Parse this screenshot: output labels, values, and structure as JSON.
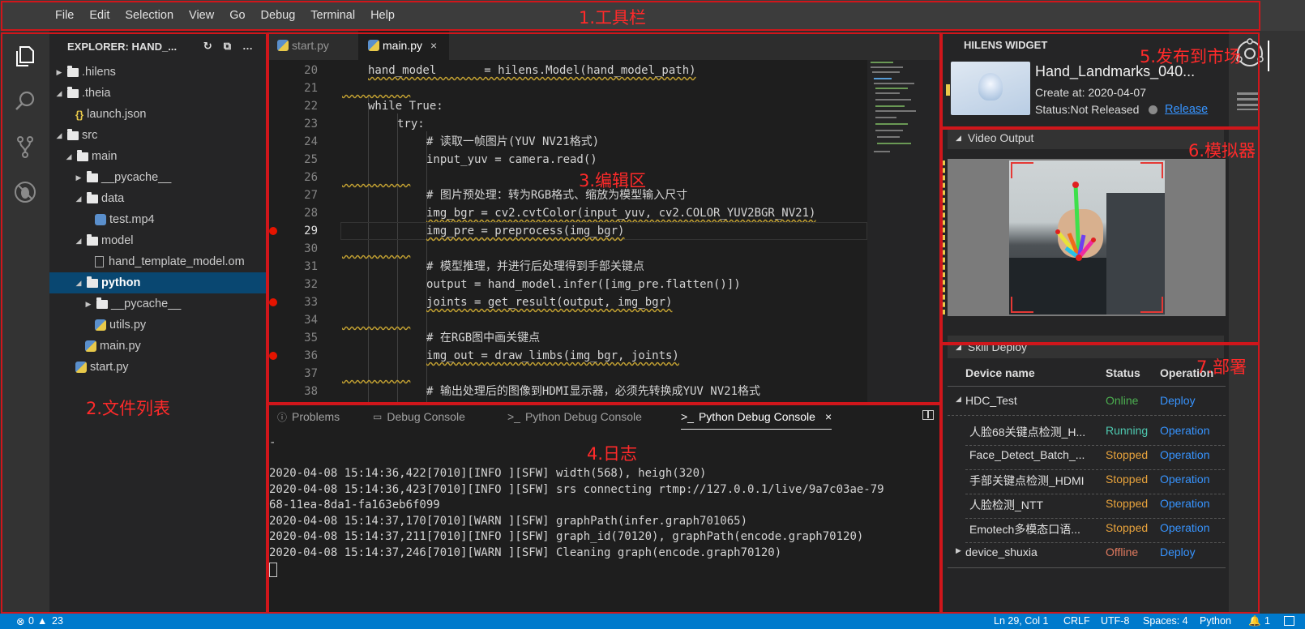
{
  "menubar": {
    "items": [
      "File",
      "Edit",
      "Selection",
      "View",
      "Go",
      "Debug",
      "Terminal",
      "Help"
    ]
  },
  "annotations": {
    "toolbar": "1.工具栏",
    "file_list": "2.文件列表",
    "editor": "3.编辑区",
    "log": "4.日志",
    "publish": "5.发布到市场",
    "simulator": "6.模拟器",
    "deploy": "7.部署"
  },
  "explorer": {
    "title": "EXPLORER: HAND_...",
    "tree": [
      {
        "label": ".hilens",
        "type": "folder",
        "depth": 0,
        "open": false
      },
      {
        "label": ".theia",
        "type": "folder",
        "depth": 0,
        "open": true
      },
      {
        "label": "launch.json",
        "type": "json",
        "depth": 1
      },
      {
        "label": "src",
        "type": "folder",
        "depth": 0,
        "open": true
      },
      {
        "label": "main",
        "type": "folder",
        "depth": 1,
        "open": true
      },
      {
        "label": "__pycache__",
        "type": "folder",
        "depth": 2,
        "open": false
      },
      {
        "label": "data",
        "type": "folder",
        "depth": 2,
        "open": true
      },
      {
        "label": "test.mp4",
        "type": "media",
        "depth": 3
      },
      {
        "label": "model",
        "type": "folder",
        "depth": 2,
        "open": true
      },
      {
        "label": "hand_template_model.om",
        "type": "file",
        "depth": 3
      },
      {
        "label": "python",
        "type": "folder",
        "depth": 2,
        "open": true,
        "selected": true
      },
      {
        "label": "__pycache__",
        "type": "folder",
        "depth": 3,
        "open": false
      },
      {
        "label": "utils.py",
        "type": "py",
        "depth": 3
      },
      {
        "label": "main.py",
        "type": "py",
        "depth": 2
      },
      {
        "label": "start.py",
        "type": "py",
        "depth": 1
      }
    ]
  },
  "editor": {
    "tabs": [
      {
        "label": "start.py",
        "active": false
      },
      {
        "label": "main.py",
        "active": true,
        "close": "×"
      }
    ],
    "lines": [
      {
        "n": "20",
        "code": "hand_model       = hilens.Model(hand_model_path)",
        "indent": 0,
        "kind": "code",
        "sq": true
      },
      {
        "n": "21",
        "code": "",
        "indent": 0,
        "kind": "blank",
        "sq": true
      },
      {
        "n": "22",
        "code": "while True:",
        "indent": 0,
        "kind": "kw"
      },
      {
        "n": "23",
        "code": "try:",
        "indent": 1,
        "kind": "kw"
      },
      {
        "n": "24",
        "code": "# 读取一帧图片(YUV NV21格式)",
        "indent": 2,
        "kind": "cm"
      },
      {
        "n": "25",
        "code": "input_yuv = camera.read()",
        "indent": 2,
        "kind": "code"
      },
      {
        "n": "26",
        "code": "",
        "indent": 0,
        "kind": "blank",
        "sq": true
      },
      {
        "n": "27",
        "code": "# 图片预处理：转为RGB格式、缩放为模型输入尺寸",
        "indent": 2,
        "kind": "cm"
      },
      {
        "n": "28",
        "code": "img_bgr = cv2.cvtColor(input_yuv, cv2.COLOR_YUV2BGR_NV21)",
        "indent": 2,
        "kind": "code",
        "sq": true
      },
      {
        "n": "29",
        "code": "img_pre = preprocess(img_bgr)",
        "indent": 2,
        "kind": "code",
        "bp": true,
        "cur": true,
        "sq": true
      },
      {
        "n": "30",
        "code": "",
        "indent": 0,
        "kind": "blank",
        "sq": true
      },
      {
        "n": "31",
        "code": "# 模型推理，并进行后处理得到手部关键点",
        "indent": 2,
        "kind": "cm"
      },
      {
        "n": "32",
        "code": "output = hand_model.infer([img_pre.flatten()])",
        "indent": 2,
        "kind": "code"
      },
      {
        "n": "33",
        "code": "joints = get_result(output, img_bgr)",
        "indent": 2,
        "kind": "code",
        "bp": true,
        "sq": true
      },
      {
        "n": "34",
        "code": "",
        "indent": 0,
        "kind": "blank",
        "sq": true
      },
      {
        "n": "35",
        "code": "# 在RGB图中画关键点",
        "indent": 2,
        "kind": "cm"
      },
      {
        "n": "36",
        "code": "img_out = draw_limbs(img_bgr, joints)",
        "indent": 2,
        "kind": "code",
        "bp": true,
        "sq": true
      },
      {
        "n": "37",
        "code": "",
        "indent": 0,
        "kind": "blank",
        "sq": true
      },
      {
        "n": "38",
        "code": "# 输出处理后的图像到HDMI显示器，必须先转换成YUV NV21格式",
        "indent": 2,
        "kind": "cm"
      }
    ]
  },
  "panel": {
    "tabs": [
      "Problems",
      "Debug Console",
      "Python Debug Console",
      "Python Debug Console"
    ],
    "active_close": "×",
    "prompt": "-",
    "log": [
      "2020-04-08 15:14:36,422[7010][INFO ][SFW] width(568), heigh(320)",
      "2020-04-08 15:14:36,423[7010][INFO ][SFW] srs connecting rtmp://127.0.0.1/live/9a7c03ae-79",
      "68-11ea-8da1-fa163eb6f099",
      "2020-04-08 15:14:37,170[7010][WARN ][SFW] graphPath(infer.graph701065)",
      "2020-04-08 15:14:37,211[7010][INFO ][SFW] graph_id(70120), graphPath(encode.graph70120)",
      "2020-04-08 15:14:37,246[7010][WARN ][SFW] Cleaning graph(encode.graph70120)"
    ]
  },
  "widget": {
    "title": "HILENS WIDGET",
    "skill_name": "Hand_Landmarks_040...",
    "created": "Create at: 2020-04-07",
    "status": "Status:Not Released",
    "release": "Release",
    "video_title": "Video Output",
    "deploy_title": "Skill Deploy",
    "deploy_cols": [
      "Device name",
      "Status",
      "Operation"
    ],
    "devices": [
      {
        "name": "HDC_Test",
        "status": "Online",
        "op": "Deploy",
        "status_color": "#4caf50",
        "expanded": true
      },
      {
        "name": "人脸68关键点检测_H...",
        "status": "Running",
        "op": "Operation",
        "status_color": "#4ec9b0",
        "child": true
      },
      {
        "name": "Face_Detect_Batch_...",
        "status": "Stopped",
        "op": "Operation",
        "status_color": "#e8a33c",
        "child": true
      },
      {
        "name": "手部关键点检测_HDMI",
        "status": "Stopped",
        "op": "Operation",
        "status_color": "#e8a33c",
        "child": true
      },
      {
        "name": "人脸检测_NTT",
        "status": "Stopped",
        "op": "Operation",
        "status_color": "#e8a33c",
        "child": true
      },
      {
        "name": "Emotech多模态口语...",
        "status": "Stopped",
        "op": "Operation",
        "status_color": "#e8a33c",
        "child": true
      },
      {
        "name": "device_shuxia",
        "status": "Offline",
        "op": "Deploy",
        "status_color": "#e07a5f",
        "expanded": false
      }
    ]
  },
  "status": {
    "errors": "0",
    "warnings": "23",
    "position": "Ln 29, Col 1",
    "eol": "CRLF",
    "encoding": "UTF-8",
    "spaces": "Spaces: 4",
    "language": "Python",
    "notifications": "1"
  },
  "colors": {
    "accent": "#007acc",
    "annotation": "#d0161b",
    "link": "#3794ff"
  }
}
